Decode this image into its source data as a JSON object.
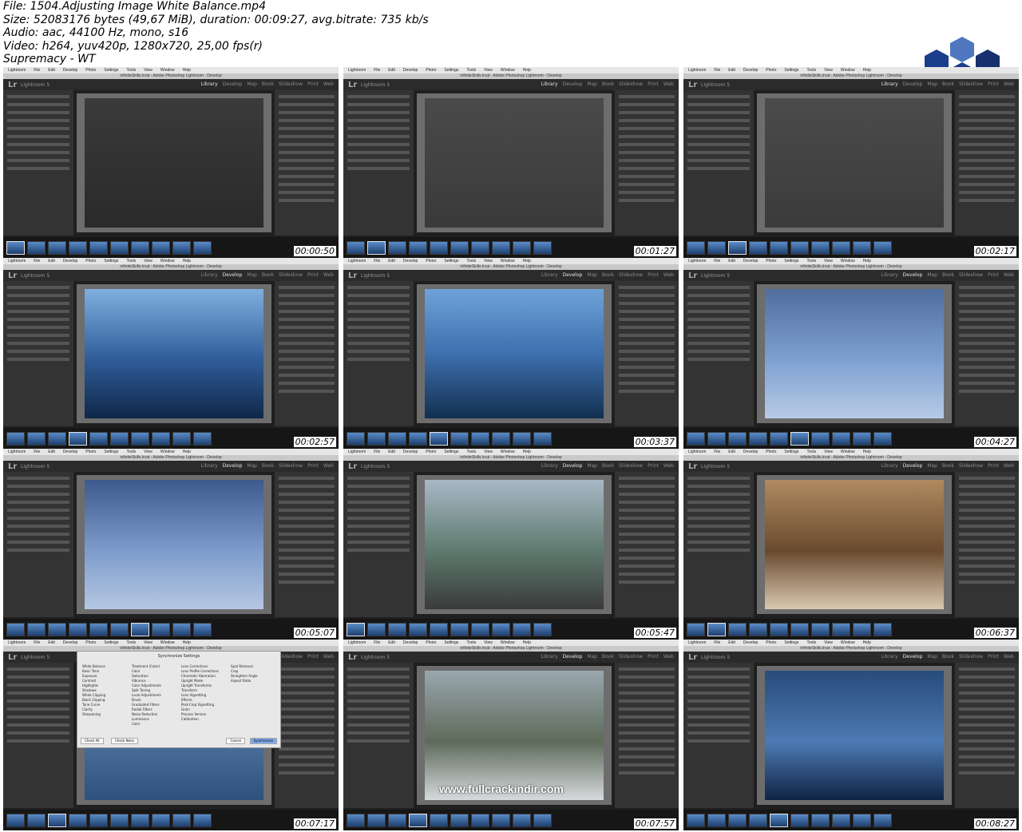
{
  "header": {
    "file": "File: 1504.Adjusting Image White Balance.mp4",
    "size": "Size: 52083176 bytes (49,67 MiB), duration: 00:09:27, avg.bitrate: 735 kb/s",
    "audio": "Audio: aac, 44100 Hz, mono, s16",
    "video": "Video: h264, yuv420p, 1280x720, 25,00 fps(r)",
    "credit": "Supremacy - WT"
  },
  "app": {
    "lr_mark": "Lr",
    "name": "Lightroom 5",
    "window_title": "infiniteSkills.lrcat - Adobe Photoshop Lightroom - Develop",
    "menu": [
      "Lightroom",
      "File",
      "Edit",
      "Develop",
      "Photo",
      "Settings",
      "Tools",
      "View",
      "Window",
      "Help"
    ],
    "modules": [
      "Library",
      "Develop",
      "Map",
      "Book",
      "Slideshow",
      "Print",
      "Web"
    ]
  },
  "frames": [
    {
      "time": "00:00:50",
      "module": "Library",
      "scene": "import"
    },
    {
      "time": "00:01:27",
      "module": "Library",
      "scene": "import-grid"
    },
    {
      "time": "00:02:17",
      "module": "Library",
      "scene": "library-grid"
    },
    {
      "time": "00:02:57",
      "module": "Develop",
      "scene": "blue-pergola"
    },
    {
      "time": "00:03:37",
      "module": "Develop",
      "scene": "blue-patio"
    },
    {
      "time": "00:04:27",
      "module": "Develop",
      "scene": "kokopelli-blue"
    },
    {
      "time": "00:05:07",
      "module": "Develop",
      "scene": "kokopelli-loupe"
    },
    {
      "time": "00:05:47",
      "module": "Develop",
      "scene": "patio-neutral"
    },
    {
      "time": "00:06:37",
      "module": "Develop",
      "scene": "pond-warm"
    },
    {
      "time": "00:07:17",
      "module": "Develop",
      "scene": "sync-dialog"
    },
    {
      "time": "00:07:57",
      "module": "Develop",
      "scene": "yard-neutral"
    },
    {
      "time": "00:08:27",
      "module": "Develop",
      "scene": "pond-blue"
    }
  ],
  "sync_dialog": {
    "title": "Synchronize Settings",
    "col1": [
      "White Balance",
      "Basic Tone",
      "Exposure",
      "Contrast",
      "Highlights",
      "Shadows",
      "White Clipping",
      "Black Clipping",
      "Tone Curve",
      "Clarity",
      "Sharpening"
    ],
    "col2": [
      "Treatment (Color)",
      "Color",
      "Saturation",
      "Vibrance",
      "Color Adjustments",
      "Split Toning",
      "Local Adjustments",
      "Brush",
      "Graduated Filters",
      "Radial Filters",
      "Noise Reduction",
      "Luminance",
      "Color"
    ],
    "col3": [
      "Lens Corrections",
      "Lens Profile Corrections",
      "Chromatic Aberration",
      "Upright Mode",
      "Upright Transforms",
      "Transform",
      "Lens Vignetting",
      "Effects",
      "Post-Crop Vignetting",
      "Grain",
      "Process Version",
      "Calibration"
    ],
    "col4": [
      "Spot Removal",
      "Crop",
      "Straighten Angle",
      "Aspect Ratio"
    ],
    "buttons": {
      "check_all": "Check All",
      "check_none": "Check None",
      "cancel": "Cancel",
      "synchronize": "Synchronize"
    }
  },
  "watermark": "www.fullcrackindir.com",
  "colors": {
    "panel": "#333333",
    "bg": "#1f1f1f",
    "accent": "#e8e8e8"
  }
}
